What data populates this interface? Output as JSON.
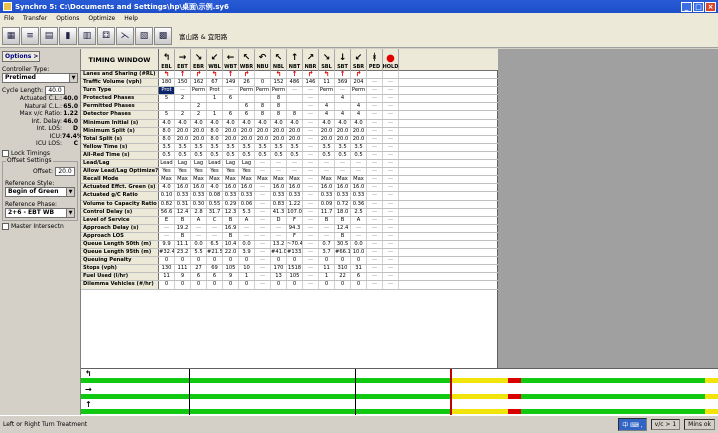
{
  "window": {
    "title": "Synchro 5: C:\\Documents and Settings\\hp\\桌面\\示例.sy6"
  },
  "menu": [
    "File",
    "Transfer",
    "Options",
    "Optimize",
    "Help"
  ],
  "toolbar": {
    "breadcrumb": "富山路 & 宜阳路"
  },
  "left": {
    "options_label": "Options >",
    "controller_type_label": "Controller Type:",
    "controller_type": "Pretimed",
    "cycle_length_label": "Cycle Length:",
    "cycle_length": "40.0",
    "stats": [
      {
        "k": "Actuated C.L.:",
        "v": "40.0"
      },
      {
        "k": "Natural C.L.:",
        "v": "65.0"
      },
      {
        "k": "Max v/c Ratio:",
        "v": "1.22"
      },
      {
        "k": "Int. Delay:",
        "v": "46.0"
      },
      {
        "k": "Int. LOS:",
        "v": "D"
      },
      {
        "k": "ICU:",
        "v": "74.4%"
      },
      {
        "k": "ICU LOS:",
        "v": "C"
      }
    ],
    "lock_timings": "Lock Timings",
    "offset_settings": "Offset Settings",
    "offset_label": "Offset:",
    "offset": "20.0",
    "ref_style_label": "Reference Style:",
    "ref_style": "Begin of Green",
    "ref_phase_label": "Reference Phase:",
    "ref_phase": "2+6 - EBT WB",
    "master_intersection": "Master Intersectn"
  },
  "grid": {
    "caption": "TIMING WINDOW",
    "columns": [
      {
        "code": "EBL",
        "icon": "↰"
      },
      {
        "code": "EBT",
        "icon": "→"
      },
      {
        "code": "EBR",
        "icon": "↘"
      },
      {
        "code": "WBL",
        "icon": "↙"
      },
      {
        "code": "WBT",
        "icon": "←"
      },
      {
        "code": "WBR",
        "icon": "↖"
      },
      {
        "code": "NBU",
        "icon": "↶"
      },
      {
        "code": "NBL",
        "icon": "↖"
      },
      {
        "code": "NBT",
        "icon": "↑"
      },
      {
        "code": "NBR",
        "icon": "↗"
      },
      {
        "code": "SBL",
        "icon": "↘"
      },
      {
        "code": "SBT",
        "icon": "↓"
      },
      {
        "code": "SBR",
        "icon": "↙"
      },
      {
        "code": "PED",
        "icon": "ᚼ"
      },
      {
        "code": "HOLD",
        "icon": "●"
      }
    ],
    "rows": [
      {
        "label": "Lanes and Sharing (#RL)",
        "cls": "arrows",
        "cells": [
          "↰",
          "↑",
          "↱",
          "↰",
          "↑",
          "↱",
          "",
          "↰",
          "↑",
          "↱",
          "↰",
          "↑",
          "↱",
          "",
          ""
        ]
      },
      {
        "label": "Traffic Volume (vph)",
        "cells": [
          "180",
          "150",
          "162",
          "67",
          "149",
          "26",
          "0",
          "152",
          "486",
          "146",
          "11",
          "369",
          "204",
          "—",
          "—"
        ]
      },
      {
        "label": "Turn Type",
        "cells": [
          "Prot",
          "—",
          "Perm",
          "Prot",
          "—",
          "Perm",
          "Perm",
          "Perm",
          "—",
          "—",
          "Perm",
          "—",
          "Perm",
          "—",
          "—"
        ]
      },
      {
        "label": "Protected Phases",
        "cells": [
          "5",
          "2",
          "",
          "1",
          "6",
          "",
          "",
          "8",
          "",
          "—",
          "",
          "4",
          "",
          "—",
          "—"
        ]
      },
      {
        "label": "Permitted Phases",
        "cells": [
          "",
          "",
          "2",
          "",
          "",
          "6",
          "8",
          "8",
          "",
          "—",
          "4",
          "",
          "4",
          "—",
          "—"
        ]
      },
      {
        "label": "Detector Phases",
        "cells": [
          "5",
          "2",
          "2",
          "1",
          "6",
          "6",
          "8",
          "8",
          "8",
          "—",
          "4",
          "4",
          "4",
          "—",
          "—"
        ]
      },
      {
        "label": "Minimum Initial (s)",
        "cells": [
          "4.0",
          "4.0",
          "4.0",
          "4.0",
          "4.0",
          "4.0",
          "4.0",
          "4.0",
          "4.0",
          "—",
          "4.0",
          "4.0",
          "4.0",
          "—",
          "—"
        ]
      },
      {
        "label": "Minimum Split (s)",
        "cells": [
          "8.0",
          "20.0",
          "20.0",
          "8.0",
          "20.0",
          "20.0",
          "20.0",
          "20.0",
          "20.0",
          "—",
          "20.0",
          "20.0",
          "20.0",
          "—",
          "—"
        ]
      },
      {
        "label": "Total Split (s)",
        "cells": [
          "8.0",
          "20.0",
          "20.0",
          "8.0",
          "20.0",
          "20.0",
          "20.0",
          "20.0",
          "20.0",
          "—",
          "20.0",
          "20.0",
          "20.0",
          "—",
          "—"
        ]
      },
      {
        "label": "Yellow Time (s)",
        "cells": [
          "3.5",
          "3.5",
          "3.5",
          "3.5",
          "3.5",
          "3.5",
          "3.5",
          "3.5",
          "3.5",
          "—",
          "3.5",
          "3.5",
          "3.5",
          "—",
          "—"
        ]
      },
      {
        "label": "All-Red Time (s)",
        "cells": [
          "0.5",
          "0.5",
          "0.5",
          "0.5",
          "0.5",
          "0.5",
          "0.5",
          "0.5",
          "0.5",
          "—",
          "0.5",
          "0.5",
          "0.5",
          "—",
          "—"
        ]
      },
      {
        "label": "Lead/Lag",
        "cells": [
          "Lead",
          "Lag",
          "Lag",
          "Lead",
          "Lag",
          "Lag",
          "—",
          "—",
          "—",
          "—",
          "—",
          "—",
          "—",
          "—",
          "—"
        ]
      },
      {
        "label": "Allow Lead/Lag Optimize?",
        "cells": [
          "Yes",
          "Yes",
          "Yes",
          "Yes",
          "Yes",
          "Yes",
          "—",
          "—",
          "—",
          "—",
          "—",
          "—",
          "—",
          "—",
          "—"
        ]
      },
      {
        "label": "Recall Mode",
        "cells": [
          "Max",
          "Max",
          "Max",
          "Max",
          "Max",
          "Max",
          "Max",
          "Max",
          "Max",
          "—",
          "Max",
          "Max",
          "Max",
          "—",
          "—"
        ]
      },
      {
        "label": "Actuated Effct. Green (s)",
        "cells": [
          "4.0",
          "16.0",
          "16.0",
          "4.0",
          "16.0",
          "16.0",
          "—",
          "16.0",
          "16.0",
          "—",
          "16.0",
          "16.0",
          "16.0",
          "—",
          "—"
        ]
      },
      {
        "label": "Actuated g/C Ratio",
        "cells": [
          "0.10",
          "0.33",
          "0.33",
          "0.08",
          "0.33",
          "0.33",
          "—",
          "0.33",
          "0.33",
          "—",
          "0.33",
          "0.33",
          "0.33",
          "—",
          "—"
        ]
      },
      {
        "label": "Volume to Capacity Ratio",
        "cells": [
          "0.82",
          "0.31",
          "0.30",
          "0.55",
          "0.29",
          "0.06",
          "—",
          "0.83",
          "1.22",
          "—",
          "0.09",
          "0.72",
          "0.36",
          "—",
          "—"
        ]
      },
      {
        "label": "Control Delay (s)",
        "cells": [
          "56.6",
          "12.4",
          "2.8",
          "31.7",
          "12.3",
          "5.3",
          "—",
          "41.3",
          "107.0",
          "—",
          "11.7",
          "18.0",
          "2.5",
          "—",
          "—"
        ]
      },
      {
        "label": "Level of Service",
        "cells": [
          "E",
          "B",
          "A",
          "C",
          "B",
          "A",
          "—",
          "D",
          "F",
          "—",
          "B",
          "B",
          "A",
          "—",
          "—"
        ]
      },
      {
        "label": "Approach Delay (s)",
        "cells": [
          "—",
          "19.2",
          "—",
          "—",
          "16.9",
          "—",
          "—",
          "—",
          "94.3",
          "—",
          "—",
          "12.4",
          "—",
          "—",
          "—"
        ]
      },
      {
        "label": "Approach LOS",
        "cells": [
          "—",
          "B",
          "—",
          "—",
          "B",
          "—",
          "—",
          "—",
          "F",
          "—",
          "—",
          "B",
          "—",
          "—",
          "—"
        ]
      },
      {
        "label": "Queue Length 50th (m)",
        "cells": [
          "9.9",
          "11.1",
          "0.0",
          "6.5",
          "10.4",
          "0.0",
          "—",
          "13.2",
          "~70.4",
          "—",
          "0.7",
          "30.5",
          "0.0",
          "—",
          "—"
        ]
      },
      {
        "label": "Queue Length 95th (m)",
        "cells": [
          "#32.4",
          "23.2",
          "5.5",
          "#21.5",
          "22.0",
          "3.9",
          "—",
          "#41.0",
          "#133.0",
          "—",
          "3.7",
          "#66.1",
          "10.0",
          "—",
          "—"
        ]
      },
      {
        "label": "Queuing Penalty",
        "cells": [
          "0",
          "0",
          "0",
          "0",
          "0",
          "0",
          "—",
          "0",
          "0",
          "—",
          "0",
          "0",
          "0",
          "—",
          "—"
        ]
      },
      {
        "label": "Stops (vph)",
        "cells": [
          "130",
          "111",
          "27",
          "69",
          "105",
          "10",
          "—",
          "170",
          "1518",
          "—",
          "11",
          "310",
          "31",
          "—",
          "—"
        ]
      },
      {
        "label": "Fuel Used (l/hr)",
        "cells": [
          "11",
          "9",
          "6",
          "6",
          "9",
          "1",
          "—",
          "13",
          "105",
          "—",
          "1",
          "22",
          "6",
          "—",
          "—"
        ]
      },
      {
        "label": "Dilemma Vehicles (#/hr)",
        "cells": [
          "0",
          "0",
          "0",
          "0",
          "0",
          "0",
          "—",
          "0",
          "0",
          "—",
          "0",
          "0",
          "0",
          "—",
          "—"
        ]
      }
    ]
  },
  "timing": {
    "lanes": [
      {
        "icon": "↰",
        "tag": "ø1",
        "tag2": "ø5",
        "p": [
          0.58,
          0.67,
          0.69
        ]
      },
      {
        "icon": "→",
        "tag": "ø2",
        "tag2": "ø6",
        "p": [
          0.58,
          0.67,
          0.69
        ]
      },
      {
        "icon": "↑",
        "tag": "ø4",
        "tag2": "ø8",
        "p": [
          0.58,
          0.67,
          0.69
        ]
      }
    ]
  },
  "status": {
    "text": "Left or Right Turn Treatment",
    "vc": "v/c > 1",
    "mins": "Mins ok"
  },
  "colors": {
    "title": "#1e4fc9",
    "green": "#11c911",
    "yellow": "#f1e40a",
    "red": "#d80000"
  }
}
